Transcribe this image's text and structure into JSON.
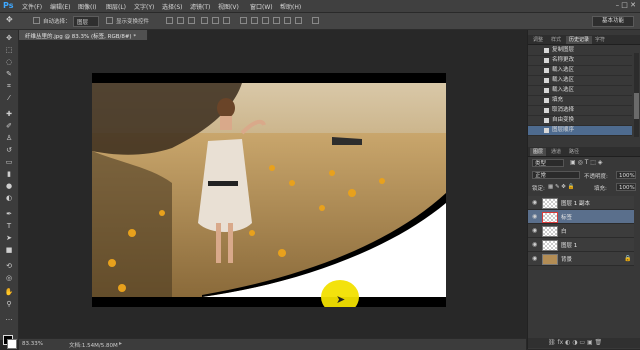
{
  "menubar": {
    "logo": "Ps",
    "items": [
      "文件(F)",
      "编辑(E)",
      "图像(I)",
      "图层(L)",
      "文字(Y)",
      "选择(S)",
      "滤镜(T)",
      "视图(V)",
      "窗口(W)",
      "帮助(H)"
    ],
    "window_controls": "–  □  ✕"
  },
  "options": {
    "auto_select_label": "自动选择：",
    "auto_select_value": "图层",
    "show_transform_label": "显示变换控件",
    "workspace": "基本功能"
  },
  "document": {
    "tab_title": "纤维丛里的.jpg @ 83.3% (标签, RGB/8#) *",
    "zoom": "83.33%",
    "doc_info": "文档:1.54M/5.80M"
  },
  "history": {
    "tabs": [
      "调整",
      "样式",
      "历史记录",
      "字符"
    ],
    "active_tab": "历史记录",
    "items": [
      "复制图层",
      "名称更改",
      "载入选区",
      "载入选区",
      "载入选区",
      "填充",
      "取消选择",
      "自由变换",
      "图层顺序"
    ],
    "selected_index": 8
  },
  "layers": {
    "tabs": [
      "图层",
      "通道",
      "路径"
    ],
    "active_tab": "图层",
    "kind_filter": "类型",
    "blend_mode": "正常",
    "opacity_label": "不透明度:",
    "opacity_value": "100%",
    "lock_label": "锁定:",
    "fill_label": "填充:",
    "fill_value": "100%",
    "rows": [
      {
        "name": "图层 1 副本",
        "selected": false
      },
      {
        "name": "标签",
        "selected": true
      },
      {
        "name": "白",
        "selected": false
      },
      {
        "name": "图层 1",
        "selected": false
      },
      {
        "name": "背景",
        "selected": false
      }
    ]
  },
  "colors": {
    "accent": "#3ea8ff",
    "selection": "#5a6f8c",
    "highlight_cursor": "#f2e000"
  }
}
